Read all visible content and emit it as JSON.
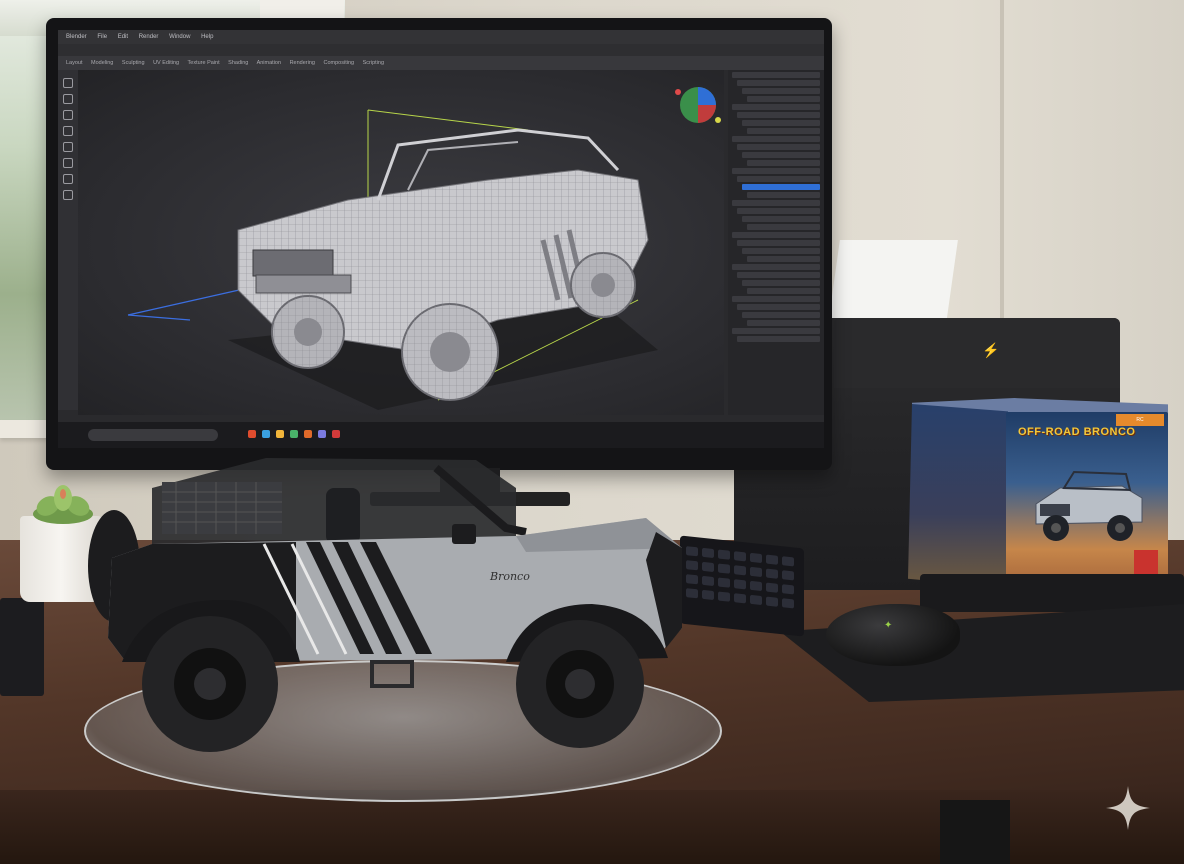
{
  "screen": {
    "menu_items": [
      "Blender",
      "File",
      "Edit",
      "Render",
      "Window",
      "Help"
    ],
    "workspace_tabs": [
      "Layout",
      "Modeling",
      "Sculpting",
      "UV Editing",
      "Texture Paint",
      "Shading",
      "Animation",
      "Rendering",
      "Compositing",
      "Scripting"
    ],
    "outliner_rows": 34,
    "selected_row": 14
  },
  "product_box": {
    "title": "OFF-ROAD BRONCO",
    "badge": "RC",
    "subtitle": "",
    "label": ""
  },
  "model": {
    "badge_script": "Bronco"
  },
  "colors": {
    "body_gray": "#a9acb0",
    "stripe_black": "#1c1c1e",
    "outliner_select": "#2f6fd6",
    "box_title": "#f3c83a"
  }
}
